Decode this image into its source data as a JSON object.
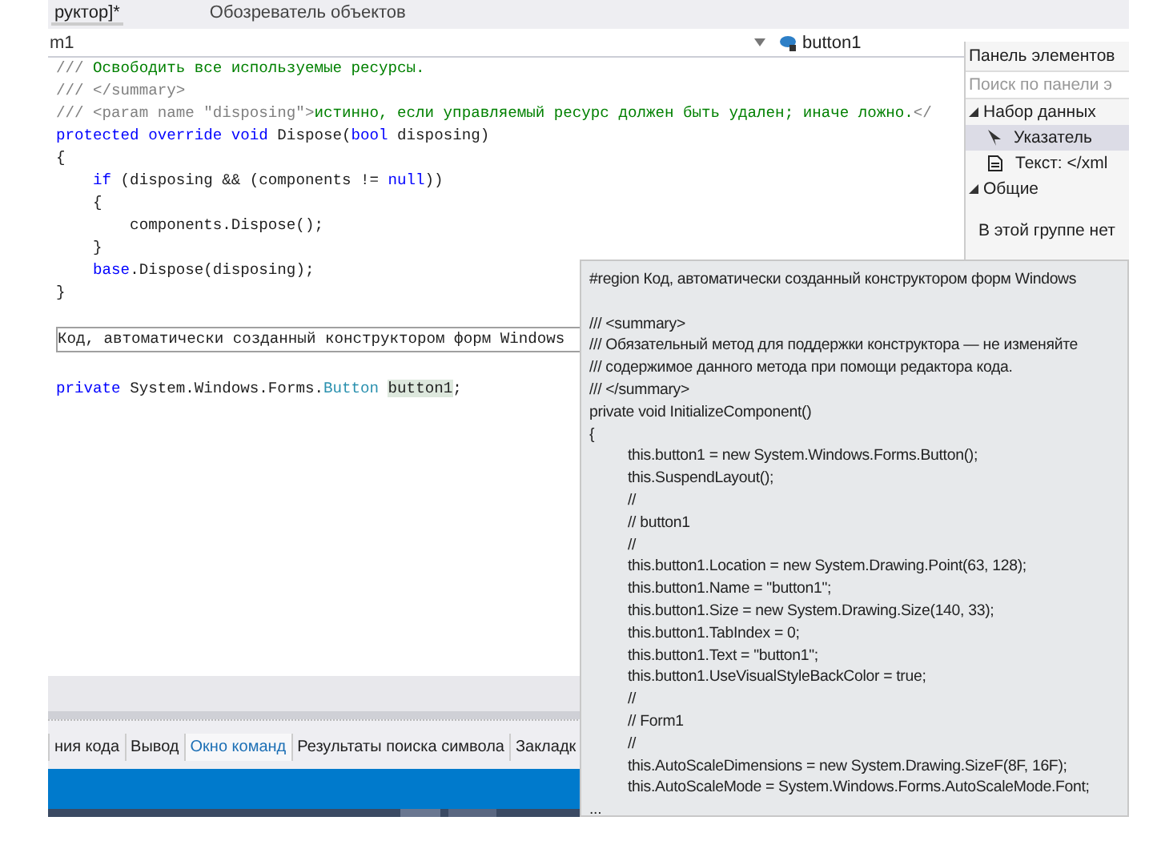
{
  "doc_tabs": [
    {
      "label": "руктор]*",
      "selected": true
    },
    {
      "label": "Обозреватель объектов",
      "selected": false
    }
  ],
  "nav_bar": {
    "left": "m1",
    "right": "button1"
  },
  "code_lines": [
    {
      "kind": "code",
      "parts": [
        {
          "kind": "doc",
          "text": "/// "
        },
        {
          "kind": "comment",
          "text": "Освободить все используемые ресурсы."
        }
      ]
    },
    {
      "kind": "code",
      "parts": [
        {
          "kind": "doc",
          "text": "/// </summary>"
        }
      ]
    },
    {
      "kind": "code",
      "parts": [
        {
          "kind": "doc",
          "text": "/// <param name \"disposing\">"
        },
        {
          "kind": "comment",
          "text": "истинно, если управляемый ресурс должен быть удален; иначе ложно."
        },
        {
          "kind": "doc",
          "text": "</"
        }
      ]
    },
    {
      "kind": "code",
      "parts": [
        {
          "kind": "keyword",
          "text": "protected override void"
        },
        {
          "kind": "plain",
          "text": " Dispose("
        },
        {
          "kind": "keyword",
          "text": "bool"
        },
        {
          "kind": "plain",
          "text": " disposing)"
        }
      ]
    },
    {
      "kind": "code",
      "parts": [
        {
          "kind": "plain",
          "text": "{"
        }
      ]
    },
    {
      "kind": "code",
      "parts": [
        {
          "kind": "keyword",
          "text": "    if"
        },
        {
          "kind": "plain",
          "text": " (disposing && (components != "
        },
        {
          "kind": "keyword",
          "text": "null"
        },
        {
          "kind": "plain",
          "text": "))"
        }
      ]
    },
    {
      "kind": "code",
      "parts": [
        {
          "kind": "plain",
          "text": "    {"
        }
      ]
    },
    {
      "kind": "code",
      "parts": [
        {
          "kind": "plain",
          "text": "        components.Dispose();"
        }
      ]
    },
    {
      "kind": "code",
      "parts": [
        {
          "kind": "plain",
          "text": "    }"
        }
      ]
    },
    {
      "kind": "code",
      "parts": [
        {
          "kind": "keyword",
          "text": "    base"
        },
        {
          "kind": "plain",
          "text": ".Dispose(disposing);"
        }
      ]
    },
    {
      "kind": "code",
      "parts": [
        {
          "kind": "plain",
          "text": "}"
        }
      ]
    },
    {
      "kind": "blank"
    },
    {
      "kind": "region",
      "parts": [
        {
          "kind": "plain",
          "text": "Код, автоматически созданный конструктором форм Windows"
        }
      ]
    },
    {
      "kind": "blank"
    },
    {
      "kind": "code",
      "parts": [
        {
          "kind": "keyword",
          "text": "private"
        },
        {
          "kind": "plain",
          "text": " System.Windows.Forms."
        },
        {
          "kind": "type",
          "text": "Button "
        },
        {
          "kind": "highlight",
          "text": "button1"
        },
        {
          "kind": "plain",
          "text": ";"
        }
      ]
    }
  ],
  "toolbox": {
    "title": "Панель элементов",
    "search_placeholder": "Поиск по панели э",
    "groups": [
      {
        "label": "Набор данных",
        "expanded": true,
        "items": [
          {
            "label": "Указатель",
            "kind": "pointer",
            "selected": true
          },
          {
            "label": "Текст: </xml",
            "kind": "text",
            "selected": false
          }
        ]
      },
      {
        "label": "Общие",
        "expanded": true
      }
    ],
    "empty_note": "В этой группе нет"
  },
  "bottom_tabs": [
    {
      "label": "ния кода",
      "selected": false
    },
    {
      "label": "Вывод",
      "selected": false
    },
    {
      "label": "Окно команд",
      "selected": true
    },
    {
      "label": "Результаты поиска символа",
      "selected": false
    },
    {
      "label": "Закладк",
      "selected": false
    }
  ],
  "popup": {
    "lines": [
      {
        "kind": "top",
        "text": "#region Код, автоматически созданный конструктором форм Windows"
      },
      {
        "kind": "blank"
      },
      {
        "kind": "top",
        "text": "/// <summary>"
      },
      {
        "kind": "top",
        "text": "/// Обязательный метод для поддержки конструктора — не изменяйте"
      },
      {
        "kind": "top",
        "text": "/// содержимое данного метода при помощи редактора кода."
      },
      {
        "kind": "top",
        "text": "/// </summary>"
      },
      {
        "kind": "top",
        "text": "private void InitializeComponent()"
      },
      {
        "kind": "top",
        "text": "{"
      },
      {
        "kind": "body",
        "text": "this.button1 = new System.Windows.Forms.Button();"
      },
      {
        "kind": "body",
        "text": "this.SuspendLayout();"
      },
      {
        "kind": "body",
        "text": "//"
      },
      {
        "kind": "body",
        "text": "// button1"
      },
      {
        "kind": "body",
        "text": "//"
      },
      {
        "kind": "body",
        "text": "this.button1.Location = new System.Drawing.Point(63, 128);"
      },
      {
        "kind": "body",
        "text": "this.button1.Name = \"button1\";"
      },
      {
        "kind": "body",
        "text": "this.button1.Size = new System.Drawing.Size(140, 33);"
      },
      {
        "kind": "body",
        "text": "this.button1.TabIndex = 0;"
      },
      {
        "kind": "body",
        "text": "this.button1.Text = \"button1\";"
      },
      {
        "kind": "body",
        "text": "this.button1.UseVisualStyleBackColor = true;"
      },
      {
        "kind": "body",
        "text": "//"
      },
      {
        "kind": "body",
        "text": "// Form1"
      },
      {
        "kind": "body",
        "text": "//"
      },
      {
        "kind": "body",
        "text": "this.AutoScaleDimensions = new System.Drawing.SizeF(8F, 16F);"
      },
      {
        "kind": "body",
        "text": "this.AutoScaleMode = System.Windows.Forms.AutoScaleMode.Font;"
      },
      {
        "kind": "top",
        "text": "..."
      }
    ]
  }
}
